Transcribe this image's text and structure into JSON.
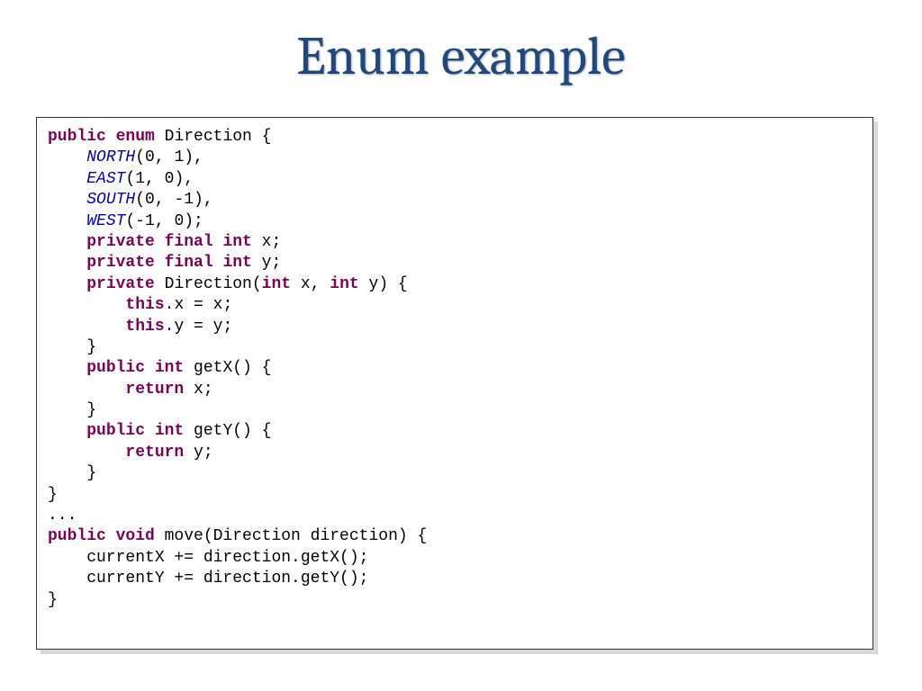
{
  "slide": {
    "title": "Enum example"
  },
  "code": {
    "tokens": [
      {
        "t": "public ",
        "c": "kw"
      },
      {
        "t": "enum ",
        "c": "kw"
      },
      {
        "t": "Direction {",
        "c": "plain"
      },
      {
        "br": 1
      },
      {
        "t": "    ",
        "c": "plain"
      },
      {
        "t": "NORTH",
        "c": "ec"
      },
      {
        "t": "(0, 1),",
        "c": "plain"
      },
      {
        "br": 1
      },
      {
        "t": "    ",
        "c": "plain"
      },
      {
        "t": "EAST",
        "c": "ec"
      },
      {
        "t": "(1, 0),",
        "c": "plain"
      },
      {
        "br": 1
      },
      {
        "t": "    ",
        "c": "plain"
      },
      {
        "t": "SOUTH",
        "c": "ec"
      },
      {
        "t": "(0, -1),",
        "c": "plain"
      },
      {
        "br": 1
      },
      {
        "t": "    ",
        "c": "plain"
      },
      {
        "t": "WEST",
        "c": "ec"
      },
      {
        "t": "(-1, 0);",
        "c": "plain"
      },
      {
        "br": 1
      },
      {
        "t": "    ",
        "c": "plain"
      },
      {
        "t": "private final int ",
        "c": "kw"
      },
      {
        "t": "x;",
        "c": "plain"
      },
      {
        "br": 1
      },
      {
        "t": "    ",
        "c": "plain"
      },
      {
        "t": "private final int ",
        "c": "kw"
      },
      {
        "t": "y;",
        "c": "plain"
      },
      {
        "br": 1
      },
      {
        "t": "    ",
        "c": "plain"
      },
      {
        "t": "private ",
        "c": "kw"
      },
      {
        "t": "Direction(",
        "c": "plain"
      },
      {
        "t": "int ",
        "c": "kw"
      },
      {
        "t": "x, ",
        "c": "plain"
      },
      {
        "t": "int ",
        "c": "kw"
      },
      {
        "t": "y) {",
        "c": "plain"
      },
      {
        "br": 1
      },
      {
        "t": "        ",
        "c": "plain"
      },
      {
        "t": "this",
        "c": "kw"
      },
      {
        "t": ".x = x;",
        "c": "plain"
      },
      {
        "br": 1
      },
      {
        "t": "        ",
        "c": "plain"
      },
      {
        "t": "this",
        "c": "kw"
      },
      {
        "t": ".y = y;",
        "c": "plain"
      },
      {
        "br": 1
      },
      {
        "t": "    }",
        "c": "plain"
      },
      {
        "br": 1
      },
      {
        "t": "    ",
        "c": "plain"
      },
      {
        "t": "public int ",
        "c": "kw"
      },
      {
        "t": "getX() {",
        "c": "plain"
      },
      {
        "br": 1
      },
      {
        "t": "        ",
        "c": "plain"
      },
      {
        "t": "return ",
        "c": "kw"
      },
      {
        "t": "x;",
        "c": "plain"
      },
      {
        "br": 1
      },
      {
        "t": "    }",
        "c": "plain"
      },
      {
        "br": 1
      },
      {
        "t": "    ",
        "c": "plain"
      },
      {
        "t": "public int ",
        "c": "kw"
      },
      {
        "t": "getY() {",
        "c": "plain"
      },
      {
        "br": 1
      },
      {
        "t": "        ",
        "c": "plain"
      },
      {
        "t": "return ",
        "c": "kw"
      },
      {
        "t": "y;",
        "c": "plain"
      },
      {
        "br": 1
      },
      {
        "t": "    }",
        "c": "plain"
      },
      {
        "br": 1
      },
      {
        "t": "}",
        "c": "plain"
      },
      {
        "br": 1
      },
      {
        "t": "...",
        "c": "plain"
      },
      {
        "br": 1
      },
      {
        "t": "public void ",
        "c": "kw"
      },
      {
        "t": "move(Direction direction) {",
        "c": "plain"
      },
      {
        "br": 1
      },
      {
        "t": "    currentX += direction.getX();",
        "c": "plain"
      },
      {
        "br": 1
      },
      {
        "t": "    currentY += direction.getY();",
        "c": "plain"
      },
      {
        "br": 1
      },
      {
        "t": "}",
        "c": "plain"
      }
    ]
  }
}
